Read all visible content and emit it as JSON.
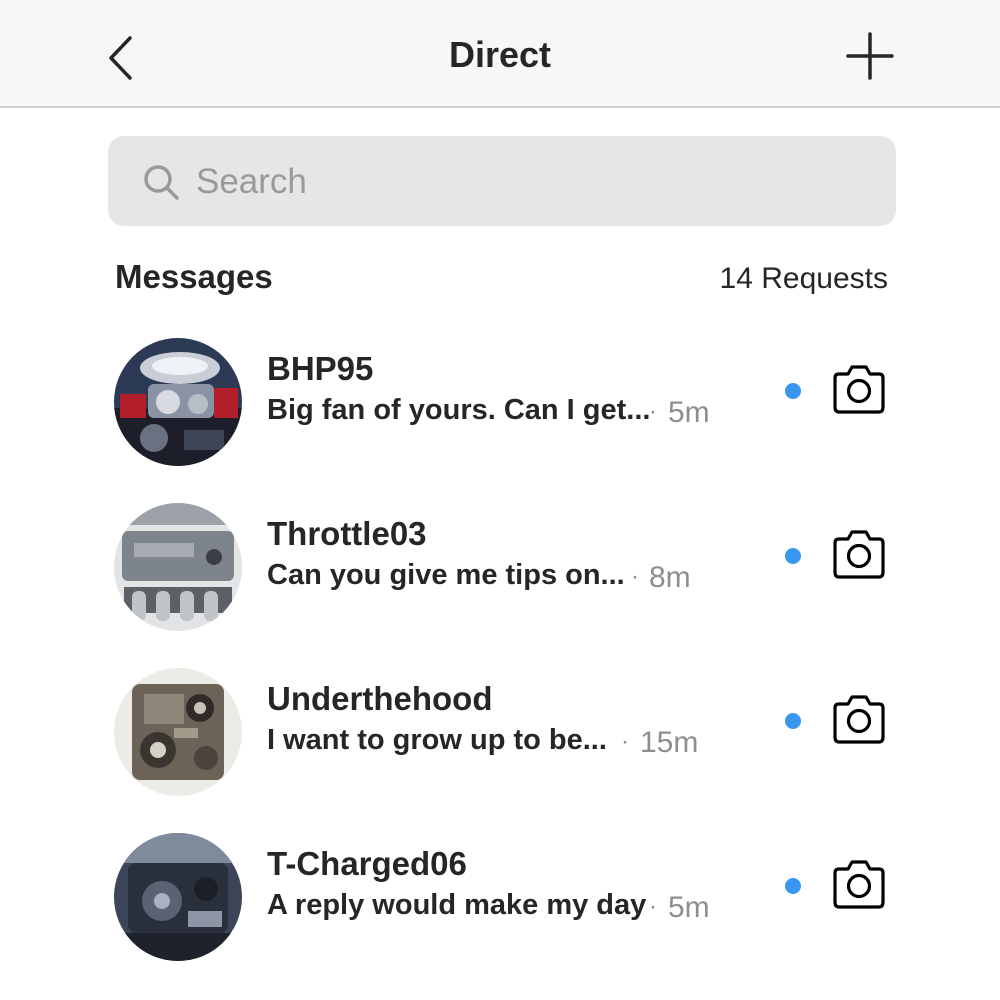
{
  "header": {
    "title": "Direct",
    "back_icon": "chevron-left-icon",
    "add_icon": "plus-icon"
  },
  "search": {
    "placeholder": "Search",
    "value": "",
    "icon": "search-icon"
  },
  "section": {
    "title": "Messages",
    "requests_label": "14 Requests"
  },
  "colors": {
    "unread_dot": "#3897f0",
    "header_bg": "#f7f7f7",
    "search_bg": "#e6e6e6",
    "muted_text": "#8e8e8e"
  },
  "threads": [
    {
      "username": "BHP95",
      "preview": "Big fan of yours. Can I get...",
      "separator": "·",
      "time": "5m",
      "unread": true,
      "avatar_icon": "engine-photo-avatar",
      "action_icon": "camera-icon"
    },
    {
      "username": "Throttle03",
      "preview": "Can you give me tips on...",
      "separator": "·",
      "time": "8m",
      "unread": true,
      "avatar_icon": "engine-photo-avatar",
      "action_icon": "camera-icon"
    },
    {
      "username": "Underthehood",
      "preview": "I want to grow up to be...",
      "separator": "·",
      "time": "15m",
      "unread": true,
      "avatar_icon": "engine-photo-avatar",
      "action_icon": "camera-icon"
    },
    {
      "username": "T-Charged06",
      "preview": "A reply would make my day",
      "separator": "·",
      "time": "5m",
      "unread": true,
      "avatar_icon": "engine-photo-avatar",
      "action_icon": "camera-icon"
    }
  ]
}
